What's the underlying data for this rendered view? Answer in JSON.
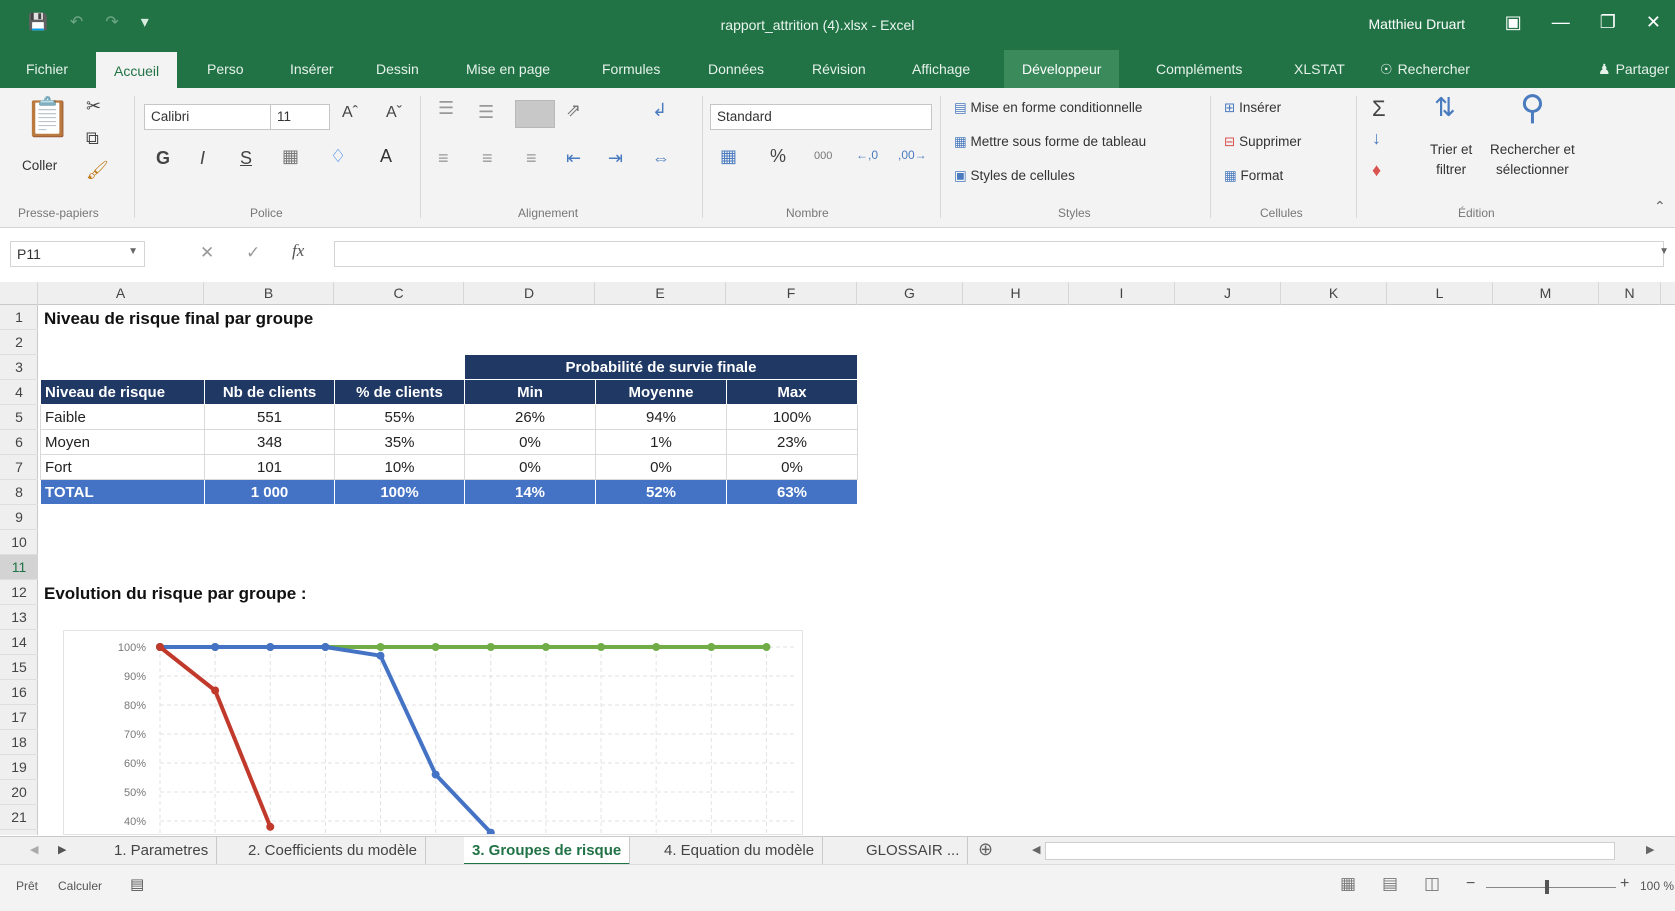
{
  "window": {
    "title": "rapport_attrition (4).xlsx - Excel",
    "user": "Matthieu Druart"
  },
  "tabs": [
    "Fichier",
    "Accueil",
    "Perso",
    "Insérer",
    "Dessin",
    "Mise en page",
    "Formules",
    "Données",
    "Révision",
    "Affichage",
    "Développeur",
    "Compléments",
    "XLSTAT",
    "Rechercher",
    "Partager"
  ],
  "ribbon": {
    "paste": "Coller",
    "font_name": "Calibri",
    "font_size": "11",
    "number_format": "Standard",
    "styles": {
      "cond": "Mise en forme conditionnelle",
      "table": "Mettre sous forme de tableau",
      "cell": "Styles de cellules"
    },
    "cells": {
      "insert": "Insérer",
      "delete": "Supprimer",
      "format": "Format"
    },
    "edit": {
      "sort_1": "Trier et",
      "sort_2": "filtrer",
      "find_1": "Rechercher et",
      "find_2": "sélectionner"
    },
    "groups": [
      "Presse-papiers",
      "Police",
      "Alignement",
      "Nombre",
      "Styles",
      "Cellules",
      "Édition"
    ]
  },
  "formula_bar": {
    "name_box": "P11",
    "fx": "fx",
    "content": ""
  },
  "columns": [
    "A",
    "B",
    "C",
    "D",
    "E",
    "F",
    "G",
    "H",
    "I",
    "J",
    "K",
    "L",
    "M",
    "N"
  ],
  "rows": [
    "1",
    "2",
    "3",
    "4",
    "5",
    "6",
    "7",
    "8",
    "9",
    "10",
    "11",
    "12",
    "13",
    "14",
    "15",
    "16",
    "17",
    "18",
    "19",
    "20",
    "21"
  ],
  "sheet": {
    "title1": "Niveau de risque final par groupe",
    "title2": "Evolution du risque par groupe :",
    "table": {
      "group_header": "Probabilité de survie finale",
      "headers": [
        "Niveau de risque",
        "Nb de clients",
        "% de clients",
        "Min",
        "Moyenne",
        "Max"
      ],
      "rows": [
        [
          "Faible",
          "551",
          "55%",
          "26%",
          "94%",
          "100%"
        ],
        [
          "Moyen",
          "348",
          "35%",
          "0%",
          "1%",
          "23%"
        ],
        [
          "Fort",
          "101",
          "10%",
          "0%",
          "0%",
          "0%"
        ]
      ],
      "total": [
        "TOTAL",
        "1 000",
        "100%",
        "14%",
        "52%",
        "63%"
      ]
    }
  },
  "chart_data": {
    "type": "line",
    "ylim": [
      40,
      100
    ],
    "y_ticks": [
      "100%",
      "90%",
      "80%",
      "70%",
      "60%",
      "50%",
      "40%"
    ],
    "x": [
      0,
      1,
      2,
      3,
      4,
      5,
      6,
      7,
      8,
      9,
      10,
      11
    ],
    "series": [
      {
        "color": "#70ad47",
        "values": [
          100,
          100,
          100,
          100,
          100,
          100,
          100,
          100,
          100,
          100,
          100,
          100
        ]
      },
      {
        "color": "#4472c4",
        "values": [
          100,
          100,
          100,
          100,
          97,
          56,
          36,
          null,
          null,
          null,
          null,
          null
        ]
      },
      {
        "color": "#c0392b",
        "values": [
          100,
          85,
          38,
          null,
          null,
          null,
          null,
          null,
          null,
          null,
          null,
          null
        ]
      }
    ]
  },
  "sheet_tabs": [
    "1. Parametres",
    "2. Coefficients du modèle",
    "3. Groupes de risque",
    "4. Equation du modèle",
    "GLOSSAIR ..."
  ],
  "active_sheet": "3. Groupes de risque",
  "status": {
    "mode": "Prêt",
    "calc": "Calculer",
    "zoom": "100 %"
  }
}
